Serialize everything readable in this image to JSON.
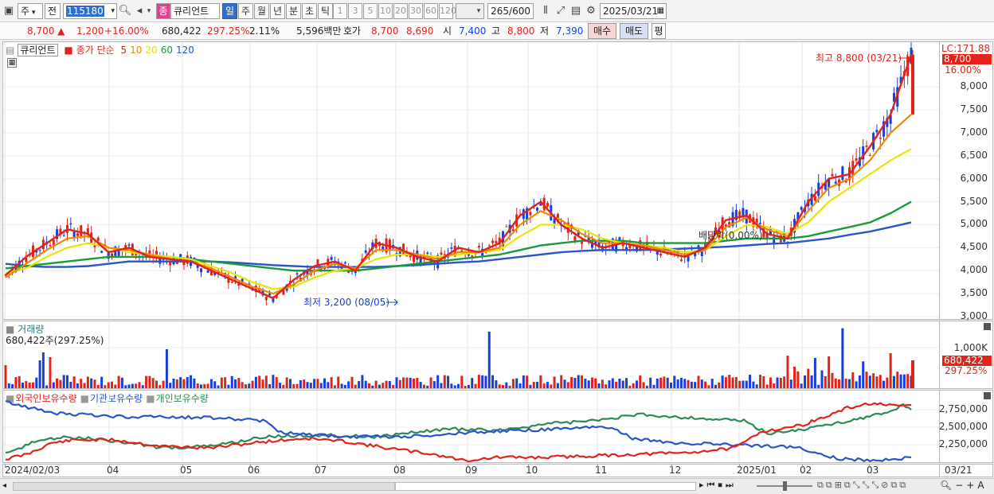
{
  "toolbar": {
    "period_select": "주",
    "prev_label": "전",
    "code": "115180",
    "name_badge": "종",
    "stock_name": "큐리언트",
    "periods": [
      "일",
      "주",
      "월",
      "년",
      "분",
      "초",
      "틱"
    ],
    "intervals": [
      "1",
      "3",
      "5",
      "10",
      "20",
      "30",
      "60",
      "120"
    ],
    "count": "265",
    "count_max": "/600",
    "date": "2025/03/21"
  },
  "quote": {
    "price": "8,700",
    "change": "1,200",
    "change_pct": "+16.00%",
    "volume": "680,422",
    "vol_ratio": "297.25%",
    "turnover_rate": "2.11%",
    "amount": "5,596백만",
    "bid_label": "호가",
    "ask": "8,700",
    "bid": "8,690",
    "open_label": "시",
    "open": "7,400",
    "high_label": "고",
    "high": "8,800",
    "low_label": "저",
    "low": "7,390",
    "buy_label": "매수",
    "sell_label": "매도",
    "eval_label": "평"
  },
  "price_panel": {
    "legend_name": "큐리언트",
    "legend_ma_title": "종가 단순",
    "ma_labels": [
      "5",
      "10",
      "20",
      "60",
      "120"
    ],
    "ma_colors": [
      "#e2231a",
      "#f08a00",
      "#e6e600",
      "#1a9a3a",
      "#2a56c8"
    ],
    "lc_label": "LC:171.88",
    "last_price_tag": "8,700",
    "last_pct_tag": "16.00%",
    "y_ticks": [
      "8,000",
      "7,500",
      "7,000",
      "6,500",
      "6,000",
      "5,500",
      "5,000",
      "4,500",
      "4,000",
      "3,500",
      "3,000"
    ],
    "high_annotation": "최고 8,800 (03/21)",
    "low_annotation": "최저 3,200 (08/05)",
    "dividend_annotation": "배당락(0.00%)"
  },
  "volume_panel": {
    "title": "거래량",
    "value": "680,422주(297.25%)",
    "y_tick": "1,000K",
    "tag_value": "680,422",
    "tag_pct": "297.25%"
  },
  "holdings_panel": {
    "labels": [
      "외국인보유수량",
      "기관보유수량",
      "개인보유수량"
    ],
    "colors": [
      "#e2231a",
      "#2a56c8",
      "#2e8b57"
    ],
    "y_ticks": [
      "2,750,000",
      "2,500,000",
      "2,250,000"
    ]
  },
  "x_axis": {
    "labels": [
      "2024/02/03",
      "04",
      "05",
      "06",
      "07",
      "08",
      "09",
      "10",
      "11",
      "12",
      "2025/01",
      "02",
      "03"
    ],
    "right_label": "03/21"
  },
  "chart_data": {
    "type": "candlestick",
    "title": "",
    "ylim": [
      3000,
      8800
    ],
    "x_range": [
      "2024/02/03",
      "2025/03/21"
    ],
    "series": [
      {
        "name": "5",
        "values": [
          3900,
          4300,
          4600,
          4900,
          4800,
          4400,
          4500,
          4300,
          4250,
          4200,
          4000,
          3800,
          3600,
          3400,
          3800,
          4100,
          4200,
          4000,
          4600,
          4500,
          4300,
          4200,
          4500,
          4400,
          4600,
          5200,
          5500,
          5000,
          4700,
          4500,
          4600,
          4500,
          4400,
          4300,
          4500,
          5100,
          5200,
          4800,
          4700,
          5500,
          6000,
          6100,
          6700,
          7400,
          8700
        ]
      },
      {
        "name": "10",
        "values": [
          3850,
          4150,
          4450,
          4700,
          4750,
          4500,
          4450,
          4350,
          4250,
          4200,
          4050,
          3850,
          3650,
          3500,
          3700,
          4000,
          4150,
          4050,
          4450,
          4450,
          4350,
          4250,
          4400,
          4400,
          4500,
          5000,
          5300,
          5100,
          4800,
          4600,
          4600,
          4550,
          4450,
          4350,
          4450,
          4950,
          5150,
          4900,
          4750,
          5300,
          5800,
          6000,
          6400,
          7000,
          7400
        ]
      },
      {
        "name": "20",
        "values": [
          3950,
          4050,
          4300,
          4500,
          4600,
          4500,
          4400,
          4350,
          4300,
          4250,
          4100,
          3950,
          3750,
          3600,
          3650,
          3850,
          4000,
          4050,
          4250,
          4350,
          4350,
          4300,
          4350,
          4400,
          4450,
          4750,
          5000,
          5000,
          4900,
          4700,
          4600,
          4550,
          4500,
          4400,
          4450,
          4750,
          5000,
          4950,
          4800,
          5050,
          5500,
          5800,
          6100,
          6400,
          6650
        ]
      },
      {
        "name": "60",
        "values": [
          4050,
          4100,
          4150,
          4200,
          4250,
          4300,
          4300,
          4300,
          4300,
          4250,
          4200,
          4150,
          4100,
          4050,
          4000,
          4000,
          4000,
          4000,
          4050,
          4100,
          4150,
          4200,
          4250,
          4300,
          4350,
          4450,
          4550,
          4600,
          4650,
          4650,
          4650,
          4600,
          4600,
          4600,
          4600,
          4650,
          4700,
          4700,
          4700,
          4750,
          4850,
          4950,
          5050,
          5250,
          5500
        ]
      },
      {
        "name": "120",
        "values": [
          4150,
          4100,
          4080,
          4080,
          4100,
          4150,
          4200,
          4200,
          4200,
          4200,
          4200,
          4180,
          4150,
          4120,
          4100,
          4080,
          4080,
          4080,
          4080,
          4100,
          4120,
          4150,
          4180,
          4200,
          4250,
          4300,
          4350,
          4400,
          4430,
          4450,
          4450,
          4450,
          4460,
          4480,
          4500,
          4520,
          4550,
          4580,
          4600,
          4650,
          4700,
          4780,
          4850,
          4950,
          5050
        ]
      }
    ]
  }
}
